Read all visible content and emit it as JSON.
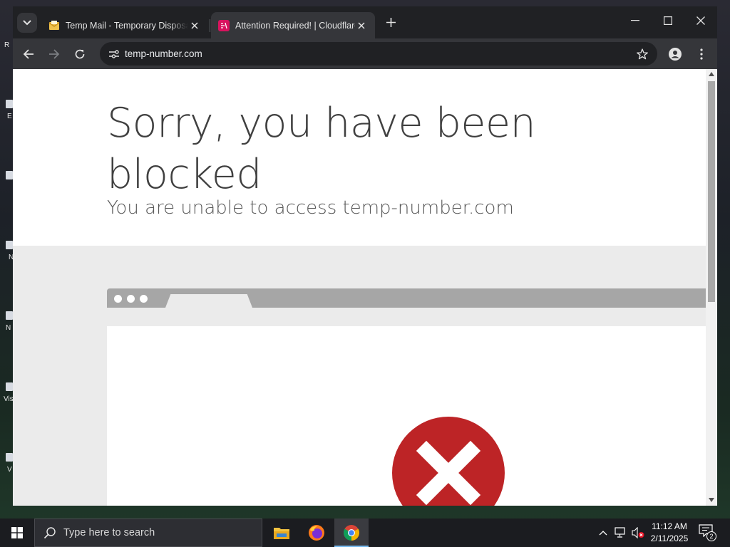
{
  "desktop": {
    "labels": [
      "R",
      "E",
      "N",
      "N",
      "Vis",
      "V"
    ]
  },
  "browser": {
    "tabs": [
      {
        "title": "Temp Mail - Temporary Disposable Email",
        "active": false
      },
      {
        "title": "Attention Required! | Cloudflare",
        "active": true
      }
    ],
    "address": "temp-number.com"
  },
  "page": {
    "title_line1": "Sorry, you have been",
    "title_line2": "blocked",
    "subtitle": "You are unable to access temp-number.com",
    "error_color": "#bd2426"
  },
  "taskbar": {
    "search_placeholder": "Type here to search",
    "time": "11:12 AM",
    "date": "2/11/2025",
    "notification_count": "2",
    "accent": "#76b9ed"
  }
}
